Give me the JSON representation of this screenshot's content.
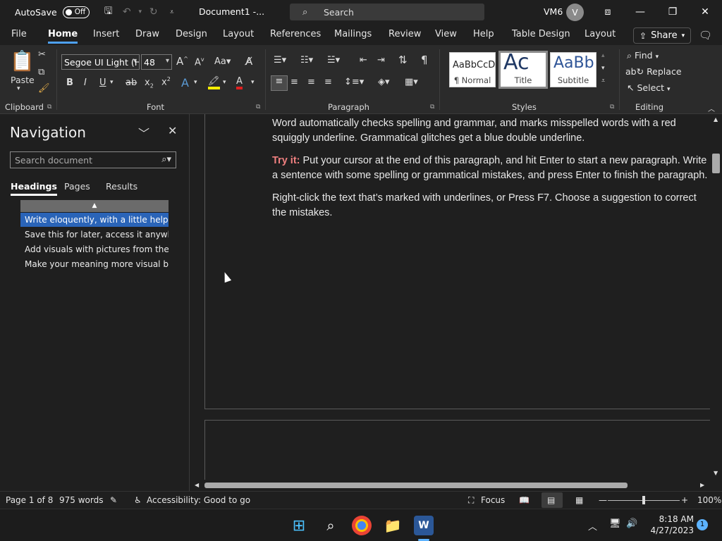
{
  "titlebar": {
    "autosave_label": "AutoSave",
    "autosave_state": "Off",
    "doc_title": "Document1  -...",
    "search_label": "Search",
    "user": "VM6",
    "avatar_initial": "V"
  },
  "ribbon_tabs": [
    "File",
    "Home",
    "Insert",
    "Draw",
    "Design",
    "Layout",
    "References",
    "Mailings",
    "Review",
    "View",
    "Help",
    "Table Design",
    "Layout"
  ],
  "active_tab": "Home",
  "share_label": "Share",
  "clipboard": {
    "paste_label": "Paste",
    "group_label": "Clipboard"
  },
  "font": {
    "family": "Segoe UI Light (H",
    "size": "48",
    "group_label": "Font"
  },
  "paragraph": {
    "group_label": "Paragraph"
  },
  "styles": {
    "group_label": "Styles",
    "items": [
      {
        "sample": "AaBbCcD",
        "name": "¶ Normal"
      },
      {
        "sample": "Ac",
        "name": "Title"
      },
      {
        "sample": "AaBb",
        "name": "Subtitle"
      }
    ]
  },
  "editing": {
    "group_label": "Editing",
    "find": "Find",
    "replace": "Replace",
    "select": "Select"
  },
  "navigation": {
    "title": "Navigation",
    "search_placeholder": "Search document",
    "tabs": [
      "Headings",
      "Pages",
      "Results"
    ],
    "headings": [
      "Write eloquently, with a little help",
      "Save this for later, access it anywhere",
      "Add visuals with pictures from the w...",
      "Make your meaning more visual by..."
    ]
  },
  "document": {
    "para1": "Word automatically checks spelling and grammar, and marks misspelled words with a red squiggly underline. Grammatical glitches get a blue double underline.",
    "tryit_label": "Try it:",
    "para2": " Put your cursor at the end of this paragraph, and hit Enter to start a new paragraph. Write a sentence with some spelling or grammatical mistakes, and press Enter to finish the paragraph.",
    "para3": "Right-click the text that’s marked with underlines, or Press F7. Choose a suggestion to correct the mistakes."
  },
  "statusbar": {
    "page": "Page 1 of 8",
    "words": "975 words",
    "accessibility": "Accessibility: Good to go",
    "focus": "Focus",
    "zoom": "100%"
  },
  "taskbar": {
    "time": "8:18 AM",
    "date": "4/27/2023",
    "notifications": "1"
  }
}
